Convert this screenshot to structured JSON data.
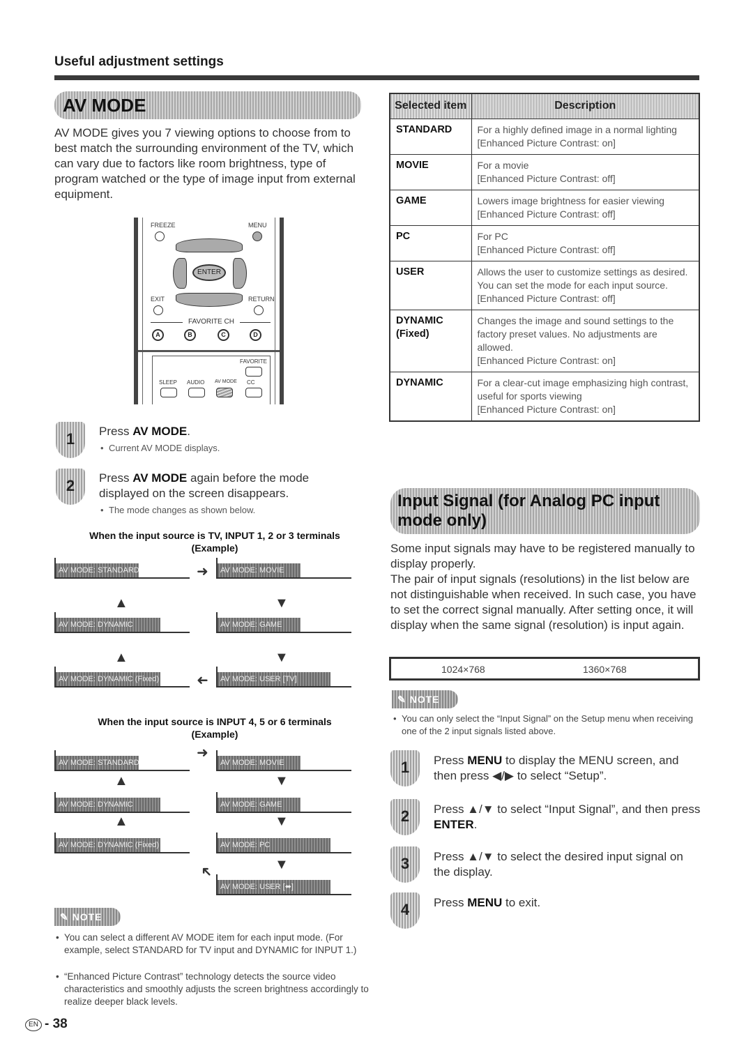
{
  "header": {
    "section_title": "Useful adjustment settings"
  },
  "av_mode": {
    "heading": "AV MODE",
    "intro": "AV MODE gives you 7 viewing options to choose from to best match the surrounding environment of the TV, which can vary due to factors like room brightness, type of program watched or the type of image input from external equipment.",
    "remote": {
      "freeze": "FREEZE",
      "menu": "MENU",
      "enter": "ENTER",
      "exit": "EXIT",
      "return": "RETURN",
      "favorite_ch": "FAVORITE CH",
      "a": "A",
      "b": "B",
      "c": "C",
      "d": "D",
      "favorite": "FAVORITE",
      "sleep": "SLEEP",
      "audio": "AUDIO",
      "av_mode": "AV MODE",
      "cc": "CC"
    },
    "steps": [
      {
        "num": "1",
        "pre": "Press ",
        "bold": "AV MODE",
        "post": ".",
        "bullet": "Current AV MODE displays."
      },
      {
        "num": "2",
        "pre": "Press ",
        "bold": "AV MODE",
        "post": " again before the mode displayed on the screen disappears.",
        "bullet": "The mode changes as shown below."
      }
    ],
    "flow1": {
      "title": "When the input source is TV, INPUT 1, 2 or 3 terminals",
      "subtitle": "(Example)",
      "boxes": [
        "AV MODE: STANDARD",
        "AV MODE: MOVIE",
        "AV MODE: DYNAMIC",
        "AV MODE: GAME",
        "AV MODE: DYNAMIC (Fixed)",
        "AV MODE: USER [TV]"
      ]
    },
    "flow2": {
      "title": "When the input source is INPUT 4, 5 or 6 terminals",
      "subtitle": "(Example)",
      "boxes": [
        "AV MODE: STANDARD",
        "AV MODE: MOVIE",
        "AV MODE: DYNAMIC",
        "AV MODE: GAME",
        "AV MODE: DYNAMIC (Fixed)",
        "AV MODE: PC",
        "AV MODE: USER [⬌]"
      ]
    },
    "note_label": "NOTE",
    "notes": [
      "You can select a different AV MODE item for each input mode. (For example, select STANDARD for TV input and DYNAMIC for INPUT 1.)",
      "“Enhanced Picture Contrast” technology detects the source video characteristics and smoothly adjusts the screen brightness accordingly to realize deeper black levels."
    ]
  },
  "mode_table": {
    "headers": [
      "Selected item",
      "Description"
    ],
    "rows": [
      {
        "item": "STANDARD",
        "desc": [
          "For a highly defined image in a normal lighting",
          "[Enhanced Picture Contrast: on]"
        ]
      },
      {
        "item": "MOVIE",
        "desc": [
          "For a movie",
          "[Enhanced Picture Contrast: off]"
        ]
      },
      {
        "item": "GAME",
        "desc": [
          "Lowers image brightness for easier viewing",
          "[Enhanced Picture Contrast: off]"
        ]
      },
      {
        "item": "PC",
        "desc": [
          "For PC",
          "[Enhanced Picture Contrast: off]"
        ]
      },
      {
        "item": "USER",
        "desc": [
          "Allows the user to customize settings as desired. You can set the mode for each input source.",
          "[Enhanced Picture Contrast: off]"
        ]
      },
      {
        "item": "DYNAMIC (Fixed)",
        "desc": [
          "Changes the image and sound settings to the factory preset values. No adjustments are allowed.",
          "[Enhanced Picture Contrast: on]"
        ]
      },
      {
        "item": "DYNAMIC",
        "desc": [
          "For a clear-cut image emphasizing high contrast, useful for sports viewing",
          "[Enhanced Picture Contrast: on]"
        ]
      }
    ]
  },
  "input_signal": {
    "heading": "Input Signal (for Analog PC input mode only)",
    "para1": "Some input signals may have to be registered manually to display properly.",
    "para2": "The pair of input signals (resolutions) in the list below are not distinguishable when received. In such case, you have to set the correct signal manually. After setting once, it will display when the same signal (resolution) is input again.",
    "resolutions": [
      "1024×768",
      "1360×768"
    ],
    "note_label": "NOTE",
    "note": "You can only select the “Input Signal” on the Setup menu when receiving one of the 2 input signals listed above.",
    "steps": [
      {
        "num": "1",
        "pre": "Press ",
        "bold": "MENU",
        "post": " to display the MENU screen, and then press ◀/▶ to select “Setup”."
      },
      {
        "num": "2",
        "pre": "Press ▲/▼ to select “Input Signal”, and then press ",
        "bold": "ENTER",
        "post": "."
      },
      {
        "num": "3",
        "pre": "Press ▲/▼ to select the desired input signal on the display.",
        "bold": "",
        "post": ""
      },
      {
        "num": "4",
        "pre": "Press ",
        "bold": "MENU",
        "post": " to exit."
      }
    ]
  },
  "footer": {
    "lang": "EN",
    "page": "- 38"
  }
}
